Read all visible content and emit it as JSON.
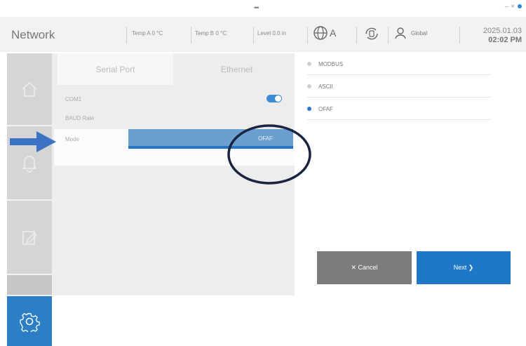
{
  "titlebar": {
    "grip": "•••",
    "window_controls": "– ×"
  },
  "header": {
    "title": "Network",
    "temp_a": "Temp A 0 °C",
    "temp_b": "Temp B 0 °C",
    "level": "Level 0.0 in",
    "globe_suffix": "A",
    "user": "Global",
    "date": "2025.01.03",
    "time": "02:02 PM"
  },
  "sidebar": {
    "items": [
      {
        "icon": "home-icon"
      },
      {
        "icon": "bell-icon"
      },
      {
        "icon": "edit-icon"
      },
      {
        "icon": "gear-icon",
        "active": true
      }
    ]
  },
  "tabs": [
    {
      "label": "Serial Port",
      "active": true
    },
    {
      "label": "Ethernet",
      "active": false
    }
  ],
  "settings": {
    "com_label": "COM1",
    "com_enabled": true,
    "baud_label": "BAUD Rate",
    "mode_label": "Mode",
    "mode_value": "OFAF"
  },
  "protocol_options": [
    {
      "label": "MODBUS",
      "selected": false
    },
    {
      "label": "ASCII",
      "selected": false
    },
    {
      "label": "OFAF",
      "selected": true
    }
  ],
  "buttons": {
    "cancel": "✕ Cancel",
    "next": "Next ❯"
  },
  "colors": {
    "accent": "#1e78c6",
    "sidebar": "#d5d5d5",
    "annotation_arrow": "#3d73c4",
    "annotation_circle": "#1b2440"
  }
}
